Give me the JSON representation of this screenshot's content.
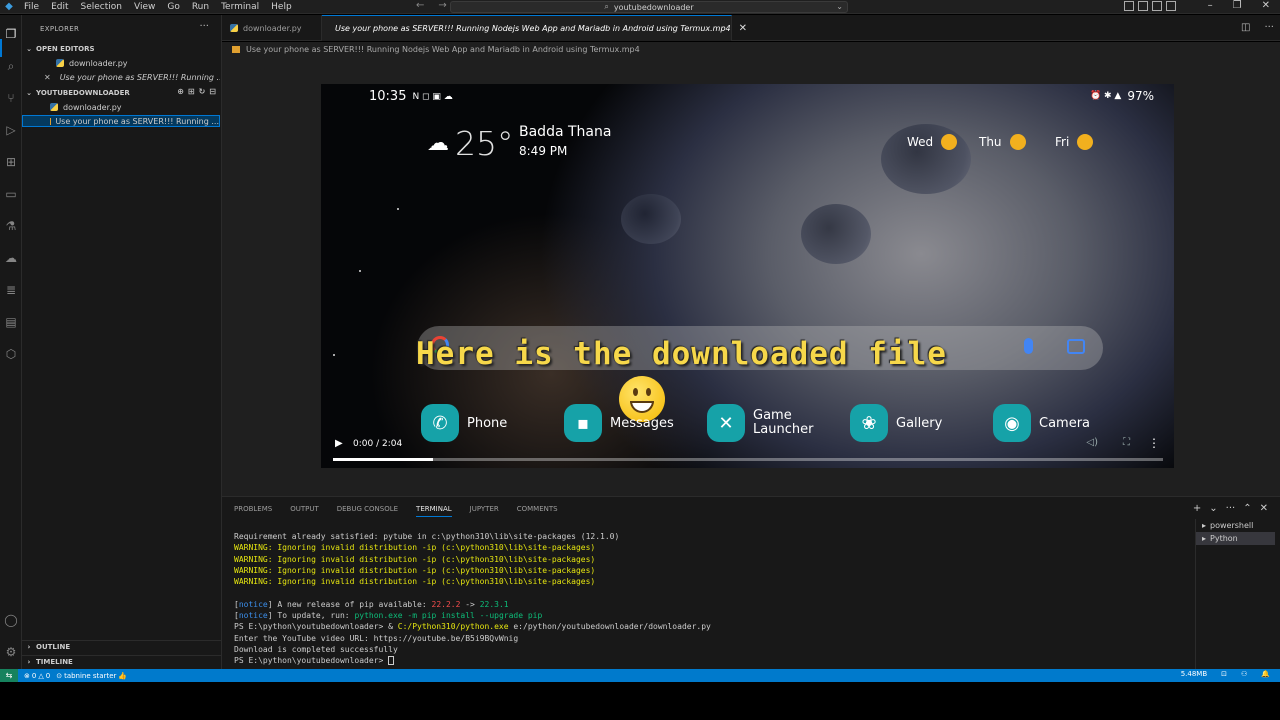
{
  "titlebar": {
    "menu": [
      "File",
      "Edit",
      "Selection",
      "View",
      "Go",
      "Run",
      "Terminal",
      "Help"
    ],
    "command_center": "youtubedownloader"
  },
  "sidebar": {
    "explorer_label": "EXPLORER",
    "open_editors_label": "OPEN EDITORS",
    "open_editors": [
      {
        "label": "downloader.py",
        "type": "py"
      },
      {
        "label": "Use your phone as SERVER!!! Running ...",
        "type": "mp4"
      }
    ],
    "folder_label": "YOUTUBEDOWNLOADER",
    "files": [
      {
        "label": "downloader.py",
        "type": "py"
      },
      {
        "label": "Use your phone as SERVER!!! Running ...",
        "type": "mp4"
      }
    ],
    "outline_label": "OUTLINE",
    "timeline_label": "TIMELINE"
  },
  "tabs": [
    {
      "label": "downloader.py",
      "type": "py"
    },
    {
      "label": "Use your phone as SERVER!!! Running Nodejs Web App and Mariadb in Android using Termux.mp4",
      "type": "mp4"
    }
  ],
  "breadcrumb": "Use your phone as SERVER!!! Running Nodejs Web App and Mariadb in Android using Termux.mp4",
  "video": {
    "phone_time": "10:35",
    "battery": "97%",
    "temperature": "25°",
    "location": "Badda Thana",
    "weather_time": "8:49 PM",
    "forecast": [
      "Wed",
      "Thu",
      "Fri"
    ],
    "caption": "Here is the downloaded file",
    "dock": [
      "Phone",
      "Messages",
      "Game Launcher",
      "Gallery",
      "Camera"
    ],
    "player_time": "0:00 / 2:04",
    "progress": 0.12
  },
  "panel": {
    "tabs": [
      "PROBLEMS",
      "OUTPUT",
      "DEBUG CONSOLE",
      "TERMINAL",
      "JUPYTER",
      "COMMENTS"
    ],
    "active_tab": "TERMINAL",
    "terminals": [
      "powershell",
      "Python"
    ],
    "lines": {
      "req": "Requirement already satisfied: pytube in c:\\python310\\lib\\site-packages (12.1.0)",
      "warn": "WARNING: Ignoring invalid distribution -ip (c:\\python310\\lib\\site-packages)",
      "notice1_label": "notice",
      "notice1_text": " A new release of pip available: ",
      "old_ver": "22.2.2",
      "arrow": " -> ",
      "new_ver": "22.3.1",
      "notice2_text": " To update, run: ",
      "upgrade_cmd": "python.exe -m pip install --upgrade pip",
      "ps_prompt": "PS E:\\python\\youtubedownloader> ",
      "amp": "& ",
      "py_exe": "C:/Python310/python.exe",
      "script": " e:/python/youtubedownloader/downloader.py",
      "enter_url": "Enter the YouTube video URL: https://youtube.be/B5i9BQvWnig",
      "done": "Download is completed successfully",
      "prompt_end": "PS E:\\python\\youtubedownloader> "
    }
  },
  "statusbar": {
    "errors": "0",
    "warnings": "0",
    "tabnine": "tabnine starter",
    "size": "5.48MB"
  }
}
